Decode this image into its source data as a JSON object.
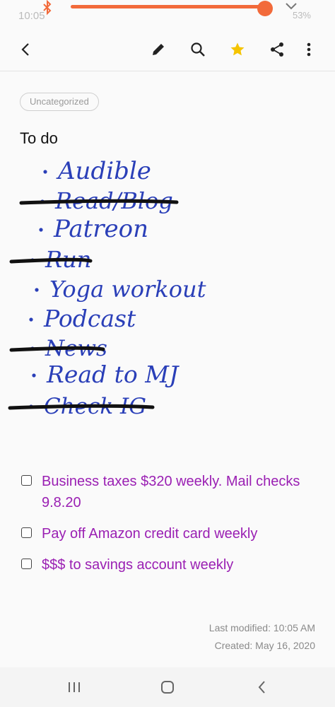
{
  "status_bar": {
    "time": "10:05",
    "battery": "53%",
    "brightness_level": 0.99
  },
  "category_label": "Uncategorized",
  "note_title": "To do",
  "handwritten_items": [
    {
      "text": "Audible",
      "struck": false
    },
    {
      "text": "Read/Blog",
      "struck": true
    },
    {
      "text": "Patreon",
      "struck": false
    },
    {
      "text": "Run",
      "struck": true
    },
    {
      "text": "Yoga workout",
      "struck": false
    },
    {
      "text": "Podcast",
      "struck": false
    },
    {
      "text": "News",
      "struck": true
    },
    {
      "text": "Read to MJ",
      "struck": false
    },
    {
      "text": "Check IG",
      "struck": true
    }
  ],
  "checklist": [
    {
      "text": "Business taxes $320 weekly. Mail checks 9.8.20",
      "checked": false
    },
    {
      "text": "Pay off Amazon credit card weekly",
      "checked": false
    },
    {
      "text": "$$$ to savings account weekly",
      "checked": false
    }
  ],
  "last_modified": "Last modified: 10:05 AM",
  "created": "Created: May 16, 2020",
  "colors": {
    "accent": "#f26a3a",
    "checklist_text": "#9a1fb3",
    "ink": "#2a3fb8",
    "star": "#f5c400"
  },
  "icons": {
    "toolbar": [
      "back-arrow-icon",
      "pen-icon",
      "search-icon",
      "star-icon",
      "share-icon",
      "more-vert-icon"
    ],
    "navbar": [
      "recents-icon",
      "home-icon",
      "back-icon"
    ]
  }
}
